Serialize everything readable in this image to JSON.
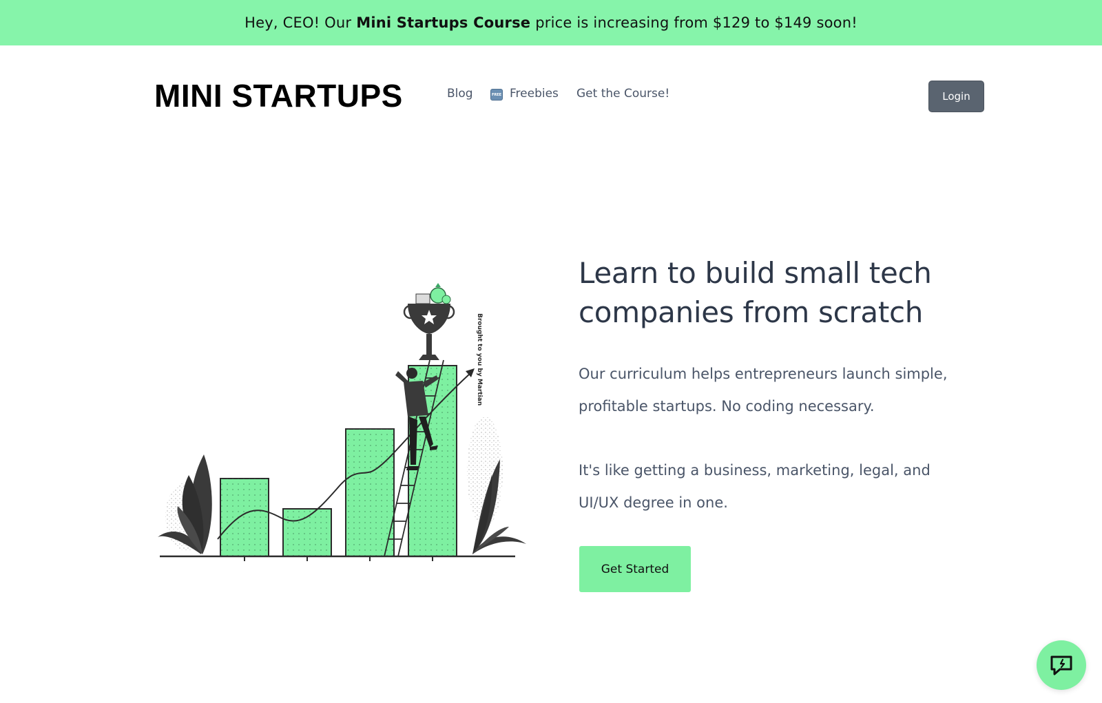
{
  "announcement": {
    "prefix": "Hey, CEO! Our",
    "highlight": "Mini Startups Course",
    "suffix": "price is increasing from $129 to $149 soon!"
  },
  "header": {
    "logo": "MINI STARTUPS",
    "nav": {
      "blog": "Blog",
      "free_badge": "FREE",
      "freebies": "Freebies",
      "course": "Get the Course!"
    },
    "login": "Login"
  },
  "hero": {
    "title": "Learn to build small tech companies from scratch",
    "paragraph1": "Our curriculum helps entrepreneurs launch simple, profitable startups. No coding necessary.",
    "paragraph2": "It's like getting a business, marketing, legal, and UI/UX degree in one.",
    "cta": "Get Started",
    "illustration_credit": "Brought to you by Martian"
  },
  "icons": {
    "chat": "chat-bubble-icon",
    "free": "free-badge-icon"
  },
  "colors": {
    "accent": "#7ef0a1",
    "banner": "#86f4aa",
    "login_bg": "#5a6470",
    "dark": "#3a3a3a"
  }
}
